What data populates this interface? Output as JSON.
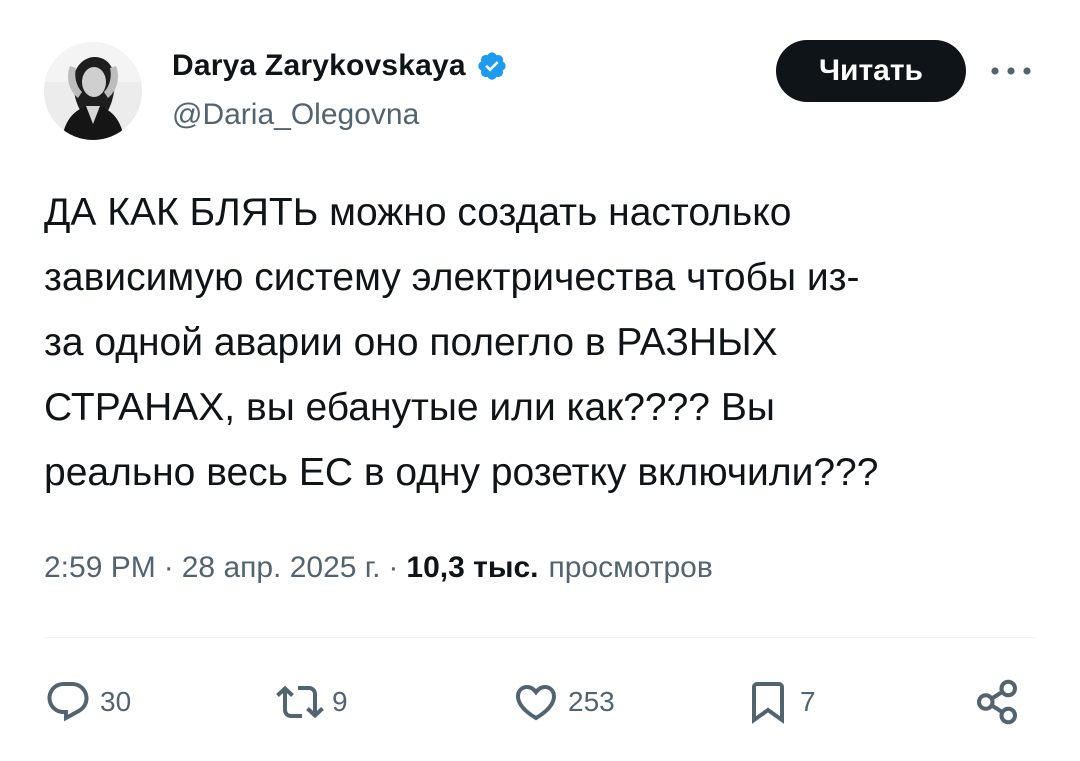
{
  "author": {
    "display_name": "Darya Zarykovskaya",
    "handle": "@Daria_Olegovna",
    "verified_icon": "verified-badge-icon",
    "verified_color": "#1d9bf0"
  },
  "follow_button": {
    "label": "Читать"
  },
  "more_icon": "more-horizontal-icon",
  "tweet": {
    "lines": [
      "ДА КАК БЛЯТЬ можно создать настолько",
      "зависимую систему электричества чтобы из-",
      "за одной аварии оно полегло в РАЗНЫХ",
      "СТРАНАХ, вы ебанутые или как???? Вы",
      "реально весь ЕС в одну розетку включили???"
    ]
  },
  "meta": {
    "time": "2:59 PM",
    "separator": "·",
    "date": "28 апр. 2025 г.",
    "views_count": "10,3 тыс.",
    "views_label": "просмотров"
  },
  "actions": {
    "replies": {
      "icon": "reply-icon",
      "count": "30"
    },
    "reposts": {
      "icon": "repost-icon",
      "count": "9"
    },
    "likes": {
      "icon": "heart-icon",
      "count": "253"
    },
    "bookmarks": {
      "icon": "bookmark-icon",
      "count": "7"
    },
    "share": {
      "icon": "share-icon"
    }
  },
  "colors": {
    "text_primary": "#0f1419",
    "text_secondary": "#536471",
    "button_bg": "#0f1419",
    "divider": "#eff3f4"
  }
}
